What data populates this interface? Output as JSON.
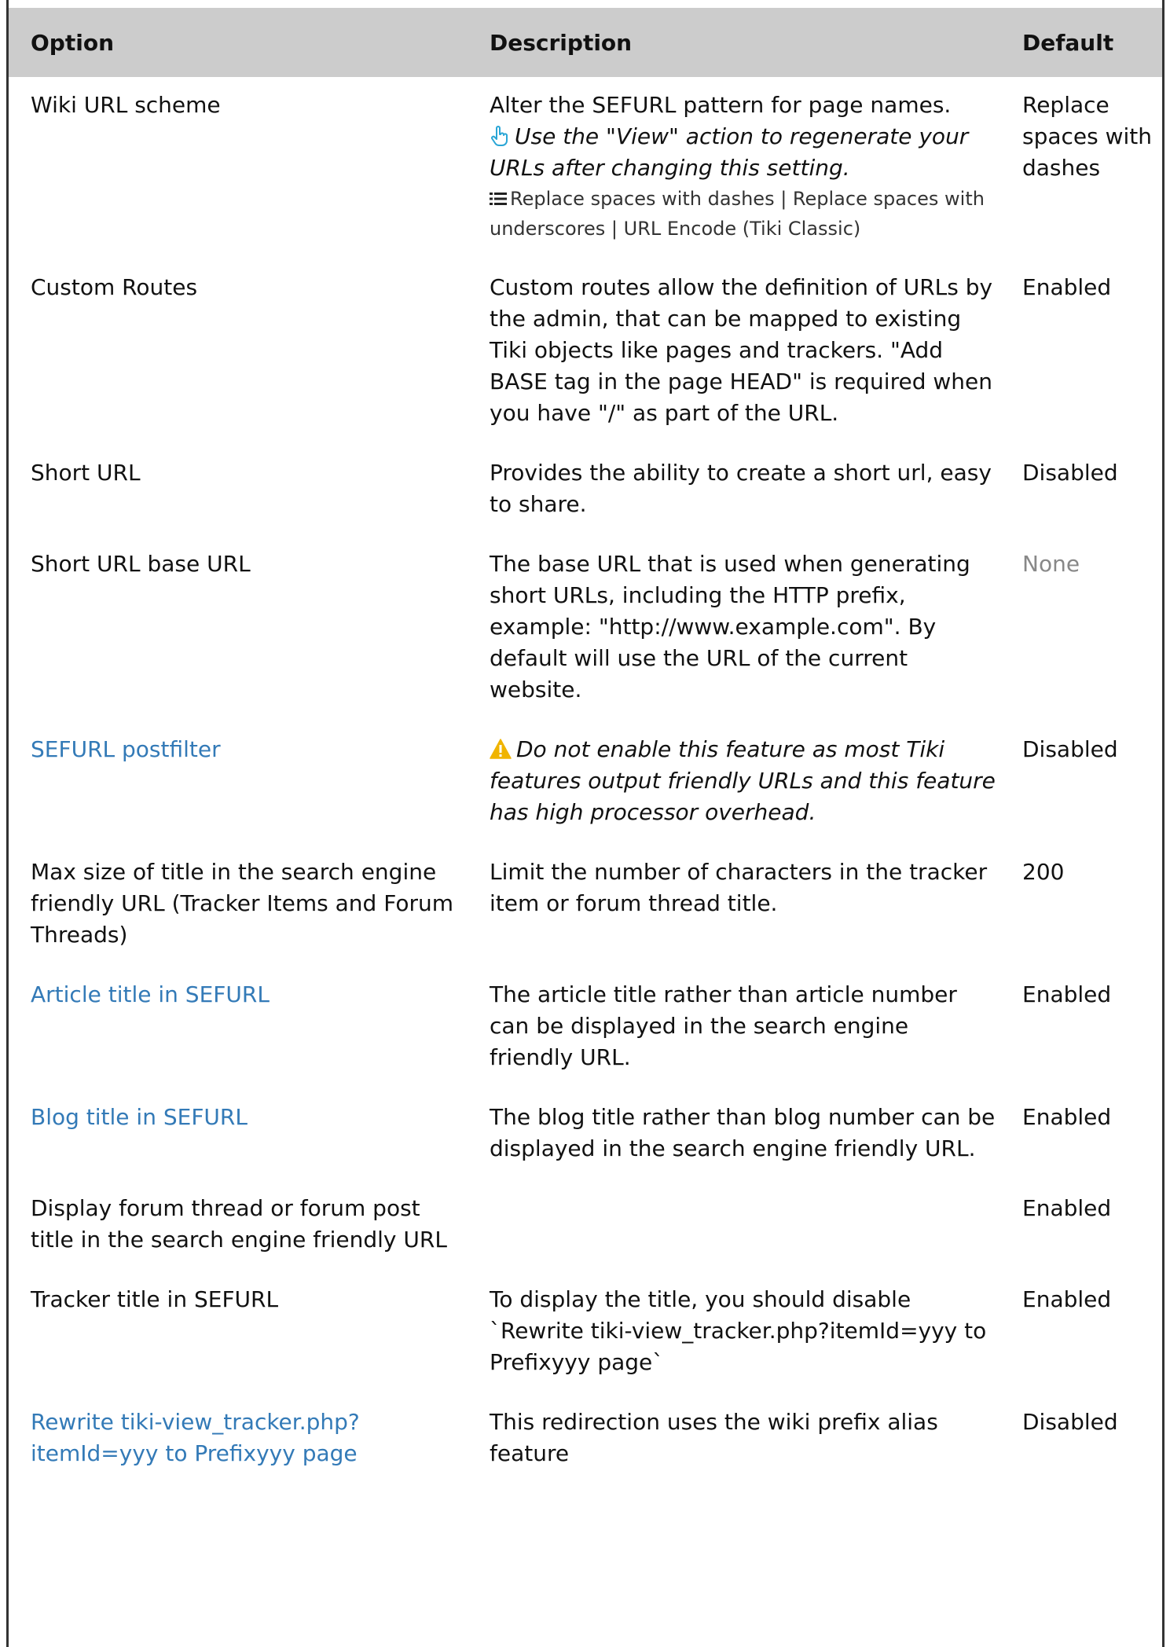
{
  "table": {
    "headers": {
      "option": "Option",
      "description": "Description",
      "default": "Default"
    },
    "rows": [
      {
        "option": "Wiki URL scheme",
        "option_is_link": false,
        "description": "Alter the SEFURL pattern for page names.",
        "note": "Use the \"View\" action to regenerate your URLs after changing this setting.",
        "note_icon": "pointing-hand-icon",
        "choices": "Replace spaces with dashes | Replace spaces with underscores | URL Encode (Tiki Classic)",
        "choices_icon": "list-icon",
        "default": "Replace spaces with dashes"
      },
      {
        "option": "Custom Routes",
        "option_is_link": false,
        "description": "Custom routes allow the definition of URLs by the admin, that can be mapped to existing Tiki objects like pages and trackers. \"Add BASE tag in the page HEAD\" is required when you have \"/\" as part of the URL.",
        "default": "Enabled"
      },
      {
        "option": "Short URL",
        "option_is_link": false,
        "description": "Provides the ability to create a short url, easy to share.",
        "default": "Disabled"
      },
      {
        "option": "Short URL base URL",
        "option_is_link": false,
        "description": "The base URL that is used when generating short URLs, including the HTTP prefix, example: \"http://www.example.com\". By default will use the URL of the current website.",
        "default": "None",
        "default_muted": true
      },
      {
        "option": "SEFURL postfilter",
        "option_is_link": true,
        "description": "",
        "warning": "Do not enable this feature as most Tiki features output friendly URLs and this feature has high processor overhead.",
        "warning_icon": "warning-icon",
        "default": "Disabled"
      },
      {
        "option": "Max size of title in the search engine friendly URL (Tracker Items and Forum Threads)",
        "option_is_link": false,
        "description": "Limit the number of characters in the tracker item or forum thread title.",
        "default": "200"
      },
      {
        "option": "Article title in SEFURL",
        "option_is_link": true,
        "description": "The article title rather than article number can be displayed in the search engine friendly URL.",
        "default": "Enabled"
      },
      {
        "option": "Blog title in SEFURL",
        "option_is_link": true,
        "description": "The blog title rather than blog number can be displayed in the search engine friendly URL.",
        "default": "Enabled"
      },
      {
        "option": "Display forum thread or forum post title in the search engine friendly URL",
        "option_is_link": false,
        "description": "",
        "default": "Enabled"
      },
      {
        "option": "Tracker title in SEFURL",
        "option_is_link": false,
        "description": "To display the title, you should disable `Rewrite tiki-view_tracker.php?itemId=yyy to Prefixyyy page`",
        "default": "Enabled"
      },
      {
        "option": "Rewrite tiki-view_tracker.php?itemId=yyy to Prefixyyy page",
        "option_is_link": true,
        "description": "This redirection uses the wiki prefix alias feature",
        "default": "Disabled"
      }
    ]
  },
  "colors": {
    "header_bg": "#cccccc",
    "link": "#337ab7",
    "muted": "#888888",
    "hand_icon": "#2aa6d6",
    "warning_icon": "#f0b400"
  }
}
